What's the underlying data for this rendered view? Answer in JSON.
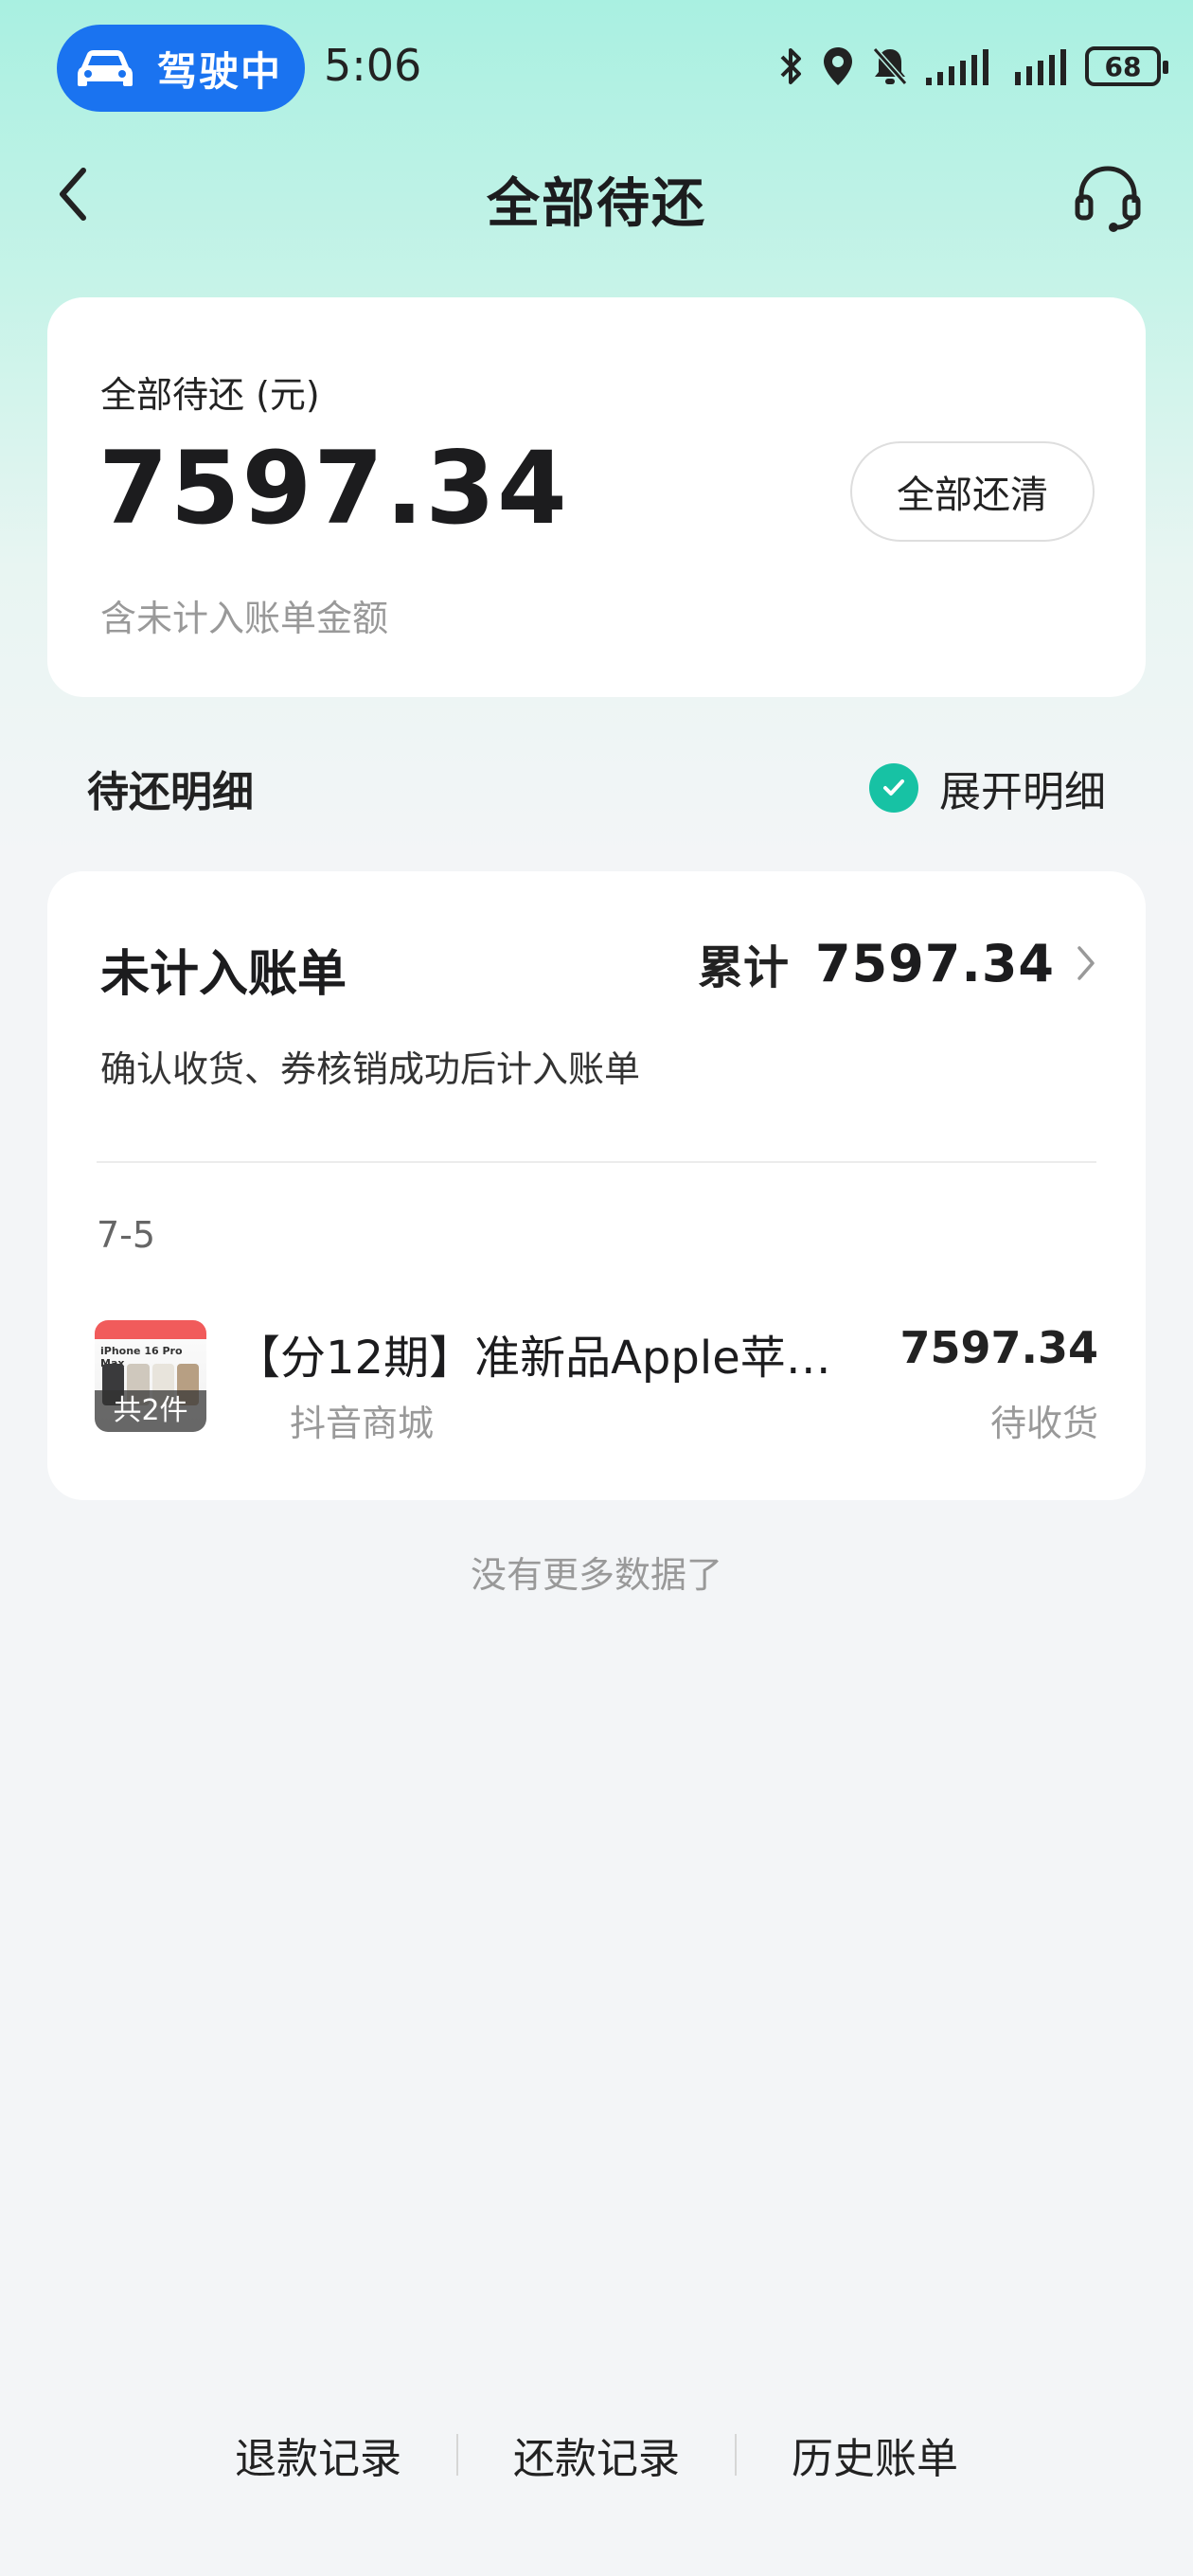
{
  "status_bar": {
    "driving_label": "驾驶中",
    "time": "5:06",
    "battery": "68",
    "icons": [
      "bluetooth-icon",
      "location-icon",
      "mute-bell-icon",
      "signal-icon",
      "signal-icon"
    ]
  },
  "nav": {
    "title": "全部待还",
    "back_icon": "chevron-left-icon",
    "support_icon": "headset-icon"
  },
  "summary": {
    "label": "全部待还 (元)",
    "amount": "7597.34",
    "note": "含未计入账单金额",
    "pay_all_label": "全部还清"
  },
  "details_header": {
    "title": "待还明细",
    "expand_label": "展开明细",
    "expand_checked": true
  },
  "unbilled": {
    "title": "未计入账单",
    "cumulative_label": "累计",
    "cumulative_amount": "7597.34",
    "description": "确认收货、券核销成功后计入账单",
    "date": "7-5",
    "orders": [
      {
        "title": "【分12期】准新品Apple苹果…",
        "shop": "抖音商城",
        "amount": "7597.34",
        "status": "待收货",
        "thumb_text": "iPhone 16 Pro Max",
        "thumb_count": "共2件"
      }
    ]
  },
  "no_more": "没有更多数据了",
  "bottom_links": [
    "退款记录",
    "还款记录",
    "历史账单"
  ],
  "colors": {
    "accent_blue": "#1a73f0",
    "accent_teal": "#17c2a4",
    "header_mint": "#a9f0e1"
  }
}
